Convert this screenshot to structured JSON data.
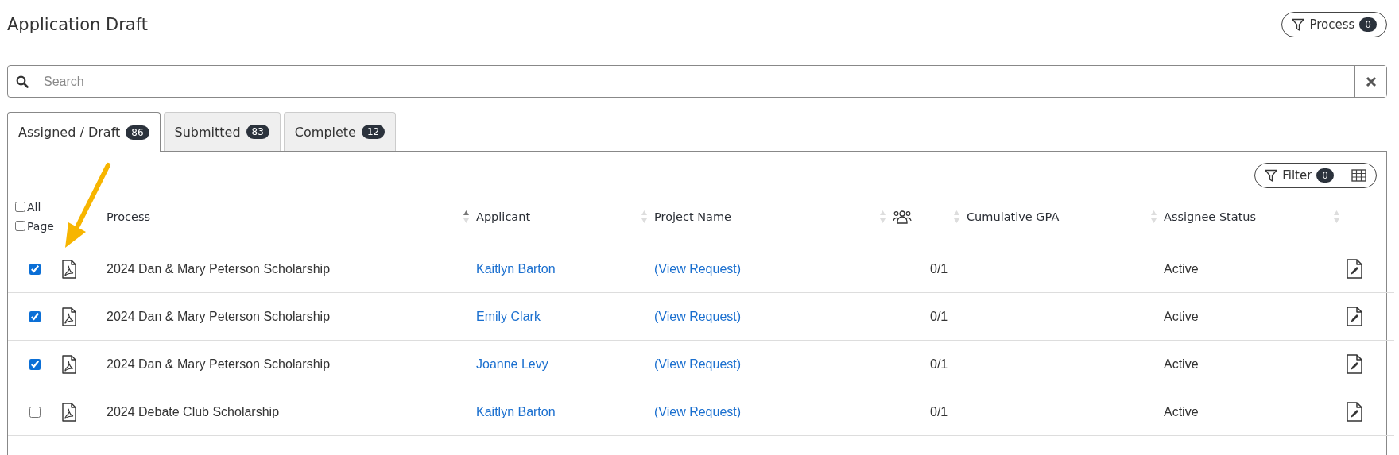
{
  "page": {
    "title": "Application Draft",
    "process_button": {
      "label": "Process",
      "count": "0"
    }
  },
  "search": {
    "placeholder": "Search"
  },
  "tabs": [
    {
      "label": "Assigned / Draft",
      "count": "86",
      "selected": true
    },
    {
      "label": "Submitted",
      "count": "83",
      "selected": false
    },
    {
      "label": "Complete",
      "count": "12",
      "selected": false
    }
  ],
  "toolbar": {
    "filter": {
      "label": "Filter",
      "count": "0"
    }
  },
  "table": {
    "select_all": {
      "label": "All",
      "checked": false
    },
    "select_page": {
      "label": "Page",
      "checked": false
    },
    "columns": [
      {
        "label": "Process",
        "kind": "text",
        "sorted": true
      },
      {
        "label": "Applicant",
        "kind": "text",
        "sorted": false
      },
      {
        "label": "Project Name",
        "kind": "text",
        "sorted": false
      },
      {
        "kind": "icon",
        "sorted": false
      },
      {
        "label": "Cumulative GPA",
        "kind": "text",
        "sorted": false
      },
      {
        "label": "Assignee Status",
        "kind": "text",
        "sorted": false
      }
    ],
    "rows": [
      {
        "checked": true,
        "process": "2024 Dan & Mary Peterson Scholarship",
        "applicant": "Kaitlyn Barton",
        "project": "(View Request)",
        "count": "0/1",
        "status": "Active"
      },
      {
        "checked": true,
        "process": "2024 Dan & Mary Peterson Scholarship",
        "applicant": "Emily Clark",
        "project": "(View Request)",
        "count": "0/1",
        "status": "Active"
      },
      {
        "checked": true,
        "process": "2024 Dan & Mary Peterson Scholarship",
        "applicant": "Joanne Levy",
        "project": "(View Request)",
        "count": "0/1",
        "status": "Active"
      },
      {
        "checked": false,
        "process": "2024 Debate Club Scholarship",
        "applicant": "Kaitlyn Barton",
        "project": "(View Request)",
        "count": "0/1",
        "status": "Active"
      }
    ]
  }
}
